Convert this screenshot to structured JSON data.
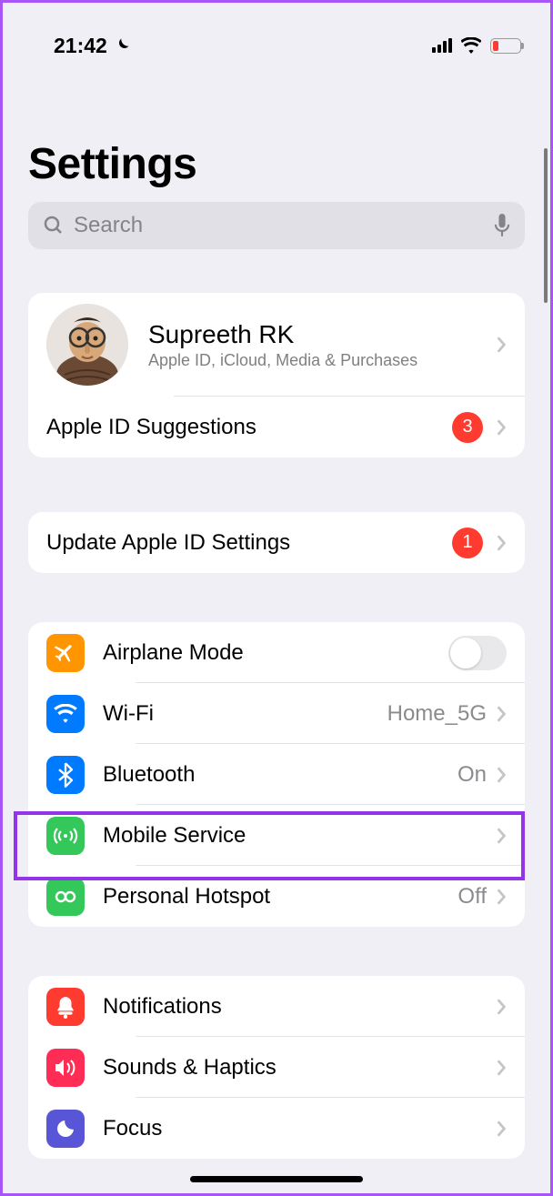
{
  "status": {
    "time": "21:42"
  },
  "title": "Settings",
  "search": {
    "placeholder": "Search"
  },
  "profile": {
    "name": "Supreeth RK",
    "subtitle": "Apple ID, iCloud, Media & Purchases"
  },
  "apple_id_suggestions": {
    "label": "Apple ID Suggestions",
    "badge": "3"
  },
  "update_apple_id": {
    "label": "Update Apple ID Settings",
    "badge": "1"
  },
  "connectivity": {
    "airplane": {
      "label": "Airplane Mode"
    },
    "wifi": {
      "label": "Wi-Fi",
      "value": "Home_5G"
    },
    "bluetooth": {
      "label": "Bluetooth",
      "value": "On"
    },
    "mobile": {
      "label": "Mobile Service"
    },
    "hotspot": {
      "label": "Personal Hotspot",
      "value": "Off"
    }
  },
  "system": {
    "notifications": {
      "label": "Notifications"
    },
    "sounds": {
      "label": "Sounds & Haptics"
    },
    "focus": {
      "label": "Focus"
    }
  }
}
